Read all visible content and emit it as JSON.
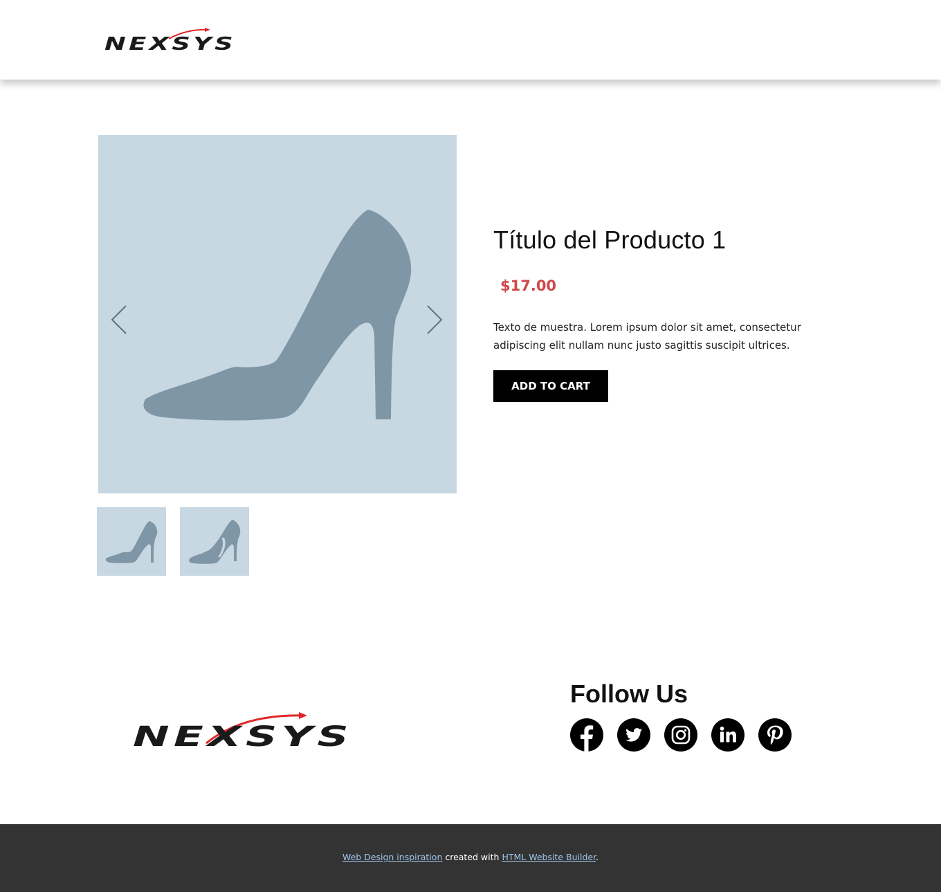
{
  "header": {
    "logo_text": "NEXSYS",
    "logo_icon": "nexsys-logo"
  },
  "product": {
    "title": "Título del Producto 1",
    "price": "$17.00",
    "description": "Texto de muestra. Lorem ipsum dolor sit amet, consectetur adipiscing elit nullam nunc justo sagittis suscipit ultrices.",
    "add_to_cart_label": "ADD TO CART",
    "gallery": {
      "prev_icon": "chevron-left-icon",
      "next_icon": "chevron-right-icon",
      "thumbnails": [
        "shoe-thumbnail-1",
        "shoe-thumbnail-2"
      ]
    }
  },
  "footer": {
    "follow_title": "Follow Us",
    "social": [
      "facebook-icon",
      "twitter-icon",
      "instagram-icon",
      "linkedin-icon",
      "pinterest-icon"
    ],
    "credit": {
      "link1": "Web Design inspiration",
      "middle": " created with ",
      "link2": "HTML Website Builder",
      "end": "."
    }
  },
  "colors": {
    "image_bg": "#c7d8e2",
    "shoe": "#7f96a6",
    "price": "#d0474a",
    "button": "#000000",
    "footer_bg": "#333333",
    "footer_link": "#9fc4ea",
    "logo_red": "#e0262a"
  }
}
